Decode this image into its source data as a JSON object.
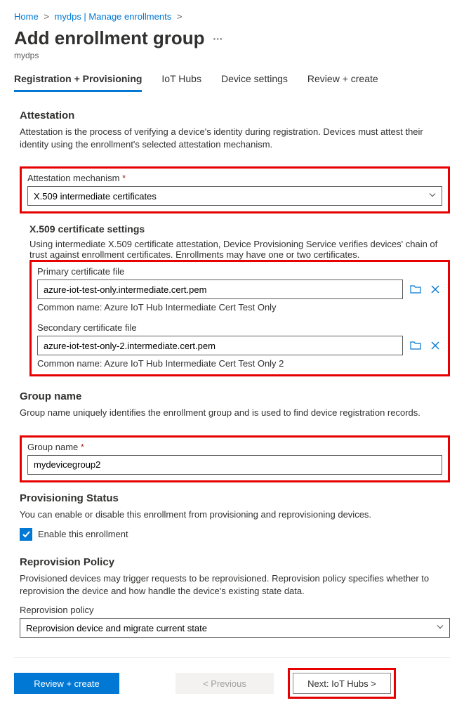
{
  "breadcrumb": {
    "home": "Home",
    "mid": "mydps | Manage enrollments"
  },
  "header": {
    "title": "Add enrollment group",
    "subtitle": "mydps"
  },
  "tabs": {
    "t1": "Registration + Provisioning",
    "t2": "IoT Hubs",
    "t3": "Device settings",
    "t4": "Review + create"
  },
  "attestation": {
    "heading": "Attestation",
    "desc": "Attestation is the process of verifying a device's identity during registration. Devices must attest their identity using the enrollment's selected attestation mechanism.",
    "mechanism_label": "Attestation mechanism",
    "mechanism_value": "X.509 intermediate certificates"
  },
  "x509": {
    "heading": "X.509 certificate settings",
    "desc": "Using intermediate X.509 certificate attestation, Device Provisioning Service verifies devices' chain of trust against enrollment certificates. Enrollments may have one or two certificates.",
    "primary_label": "Primary certificate file",
    "primary_value": "azure-iot-test-only.intermediate.cert.pem",
    "primary_cn": "Common name: Azure IoT Hub Intermediate Cert Test Only",
    "secondary_label": "Secondary certificate file",
    "secondary_value": "azure-iot-test-only-2.intermediate.cert.pem",
    "secondary_cn": "Common name: Azure IoT Hub Intermediate Cert Test Only 2"
  },
  "group": {
    "heading": "Group name",
    "desc": "Group name uniquely identifies the enrollment group and is used to find device registration records.",
    "label": "Group name",
    "value": "mydevicegroup2"
  },
  "provisioning": {
    "heading": "Provisioning Status",
    "desc": "You can enable or disable this enrollment from provisioning and reprovisioning devices.",
    "checkbox_label": "Enable this enrollment"
  },
  "reprovision": {
    "heading": "Reprovision Policy",
    "desc": "Provisioned devices may trigger requests to be reprovisioned. Reprovision policy specifies whether to reprovision the device and how handle the device's existing state data.",
    "label": "Reprovision policy",
    "value": "Reprovision device and migrate current state"
  },
  "footer": {
    "review": "Review + create",
    "prev": "< Previous",
    "next": "Next: IoT Hubs >"
  }
}
